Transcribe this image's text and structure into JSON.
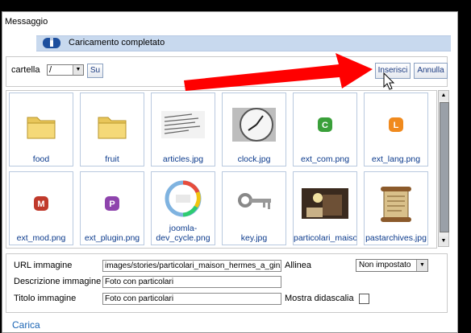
{
  "message": {
    "title": "Messaggio",
    "text": "Caricamento completato",
    "icon": "info-icon"
  },
  "toolbar": {
    "folder_label": "cartella",
    "folder_value": "/",
    "up_label": "Su",
    "insert_label": "Inserisci",
    "cancel_label": "Annulla"
  },
  "gallery": {
    "items": [
      {
        "label": "food",
        "icon": "folder-icon"
      },
      {
        "label": "fruit",
        "icon": "folder-icon"
      },
      {
        "label": "articles.jpg",
        "icon": "image-thumbnail"
      },
      {
        "label": "clock.jpg",
        "icon": "image-thumbnail"
      },
      {
        "label": "ext_com.png",
        "icon": "c-badge-icon",
        "badge": "C",
        "color": "#3aa03a"
      },
      {
        "label": "ext_lang.png",
        "icon": "l-badge-icon",
        "badge": "L",
        "color": "#f08a1e"
      },
      {
        "label": "ext_mod.png",
        "icon": "m-badge-icon",
        "badge": "M",
        "color": "#c0392b"
      },
      {
        "label": "ext_plugin.png",
        "icon": "p-badge-icon",
        "badge": "P",
        "color": "#8e44ad"
      },
      {
        "label": "joomla-dev_cycle.png",
        "label_line1": "joomla-",
        "label_line2": "dev_cycle.png",
        "icon": "image-thumbnail"
      },
      {
        "label": "key.jpg",
        "icon": "image-thumbnail"
      },
      {
        "label": "particolari_maiso",
        "icon": "image-thumbnail"
      },
      {
        "label": "pastarchives.jpg",
        "icon": "image-thumbnail"
      }
    ]
  },
  "form": {
    "url_label": "URL immagine",
    "url_value": "images/stories/particolari_maison_hermes_a_ginza",
    "align_label": "Allinea",
    "align_value": "Non impostato",
    "desc_label": "Descrizione immagine",
    "desc_value": "Foto con particolari",
    "title_label": "Titolo immagine",
    "title_value": "Foto con particolari",
    "caption_label": "Mostra didascalia",
    "caption_checked": false
  },
  "upload": {
    "label": "Carica"
  },
  "colors": {
    "annotation_arrow": "#ff0000",
    "link_blue": "#0b3a8c"
  }
}
